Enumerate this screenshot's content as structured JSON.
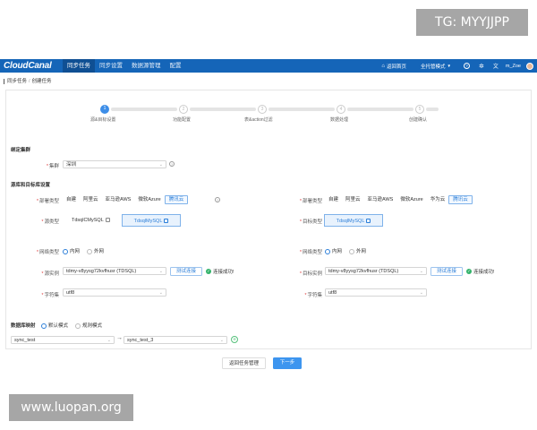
{
  "watermarks": {
    "top": "TG: MYYJJPP",
    "bottom": "www.luopan.org"
  },
  "navbar": {
    "logo": "CloudCanal",
    "tabs": [
      {
        "label": "同步任务",
        "active": true
      },
      {
        "label": "同步设置",
        "active": false
      },
      {
        "label": "数据源管理",
        "active": false
      },
      {
        "label": "配置",
        "active": false
      }
    ],
    "home_link": "返回首页",
    "mode": "全托管模式",
    "user": "m_Zoe"
  },
  "breadcrumb": {
    "parent": "同步任务",
    "current": "创建任务"
  },
  "steps": [
    {
      "num": "1",
      "label": "源&目标设置",
      "active": true
    },
    {
      "num": "2",
      "label": "功能配置",
      "active": false
    },
    {
      "num": "3",
      "label": "表&action过滤",
      "active": false
    },
    {
      "num": "4",
      "label": "数据处理",
      "active": false
    },
    {
      "num": "5",
      "label": "创建确认",
      "active": false
    }
  ],
  "cluster": {
    "section": "绑定集群",
    "label": "集群",
    "value": "深圳"
  },
  "dbsection": "源库和目标库设置",
  "source": {
    "deploy_label": "部署类型",
    "deploy_options": [
      "自建",
      "阿里云",
      "亚马逊AWS",
      "微软Azure",
      "腾讯云"
    ],
    "deploy_selected": "腾讯云",
    "dbtype_label": "源类型",
    "dbtypes": [
      "TdsqlCMySQL",
      "TdsqlMySQL"
    ],
    "dbtype_selected": "TdsqlMySQL",
    "network_label": "网络类型",
    "network_options": [
      "内网",
      "外网"
    ],
    "network_selected": "内网",
    "instance_label": "源实例",
    "instance_value": "tdmy-v8yysg72kvfhusr (TDSQL)",
    "test_button": "测试连接",
    "test_result": "连接成功!",
    "charset_label": "字符集",
    "charset_value": "utf8"
  },
  "target": {
    "deploy_label": "部署类型",
    "deploy_options": [
      "自建",
      "阿里云",
      "亚马逊AWS",
      "微软Azure",
      "华为云",
      "腾讯云"
    ],
    "deploy_selected": "腾讯云",
    "dbtype_label": "目标类型",
    "dbtypes": [
      "TdsqlMySQL"
    ],
    "dbtype_selected": "TdsqlMySQL",
    "network_label": "网络类型",
    "network_options": [
      "内网",
      "外网"
    ],
    "network_selected": "内网",
    "instance_label": "目标实例",
    "instance_value": "tdmy-v8yysg72kvfhusr (TDSQL)",
    "test_button": "测试连接",
    "test_result": "连接成功!",
    "charset_label": "字符集",
    "charset_value": "utf8"
  },
  "mapping": {
    "label": "数据库映射",
    "modes": [
      "默认模式",
      "规则模式"
    ],
    "mode_selected": "默认模式",
    "source_db": "sync_test",
    "target_db": "sync_test_3"
  },
  "footer": {
    "back": "返回任务管理",
    "next": "下一步"
  }
}
